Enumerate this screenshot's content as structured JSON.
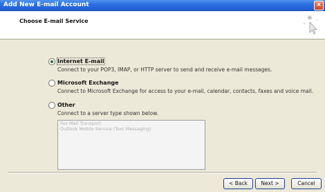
{
  "window": {
    "title": "Add New E-mail Account",
    "close_glyph": "×"
  },
  "header": {
    "title": "Choose E-mail Service",
    "icon": "mail-cursor-sparkle-icon"
  },
  "options": [
    {
      "label": "Internet E-mail",
      "description": "Connect to your POP3, IMAP, or HTTP server to send and receive e-mail messages.",
      "selected": true
    },
    {
      "label": "Microsoft Exchange",
      "description": "Connect to Microsoft Exchange for access to your e-mail, calendar, contacts, faxes and voice mail.",
      "selected": false
    },
    {
      "label": "Other",
      "description": "Connect to a server type shown below.",
      "selected": false
    }
  ],
  "other_server_types": [
    "Fax Mail Transport",
    "Outlook Mobile Service (Text Messaging)"
  ],
  "buttons": {
    "back": "< Back",
    "next": "Next >",
    "cancel": "Cancel"
  }
}
